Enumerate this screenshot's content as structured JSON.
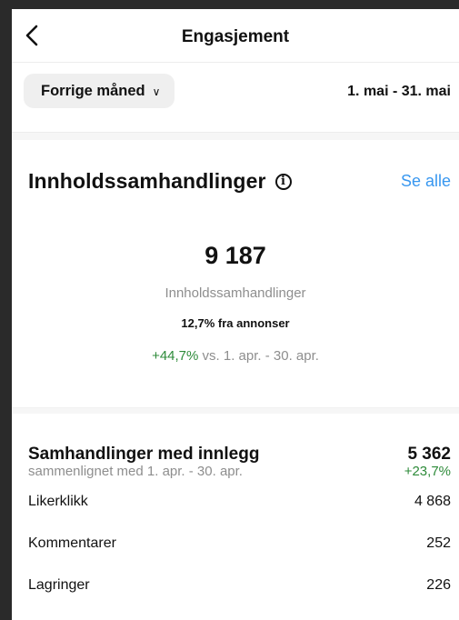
{
  "header": {
    "title": "Engasjement",
    "back_icon": "chevron-left-icon"
  },
  "period": {
    "selector_label": "Forrige måned",
    "chevron": "∨",
    "date_range": "1. mai - 31. mai"
  },
  "content_interactions": {
    "title": "Innholdssamhandlinger",
    "info_glyph": "i",
    "see_all": "Se alle",
    "total": "9 187",
    "total_label": "Innholdssamhandlinger",
    "ads_share": "12,7% fra annonser",
    "change": "+44,7%",
    "compare_text": " vs. 1. apr. - 30. apr."
  },
  "post_interactions": {
    "title": "Samhandlinger med innlegg",
    "subtitle": "sammenlignet med 1. apr. - 30. apr.",
    "total": "5 362",
    "change": "+23,7%",
    "metrics": [
      {
        "label": "Likerklikk",
        "value": "4 868"
      },
      {
        "label": "Kommentarer",
        "value": "252"
      },
      {
        "label": "Lagringer",
        "value": "226"
      }
    ]
  },
  "colors": {
    "link": "#3897f0",
    "positive": "#2e8b3a",
    "muted": "#8e8e8e"
  }
}
